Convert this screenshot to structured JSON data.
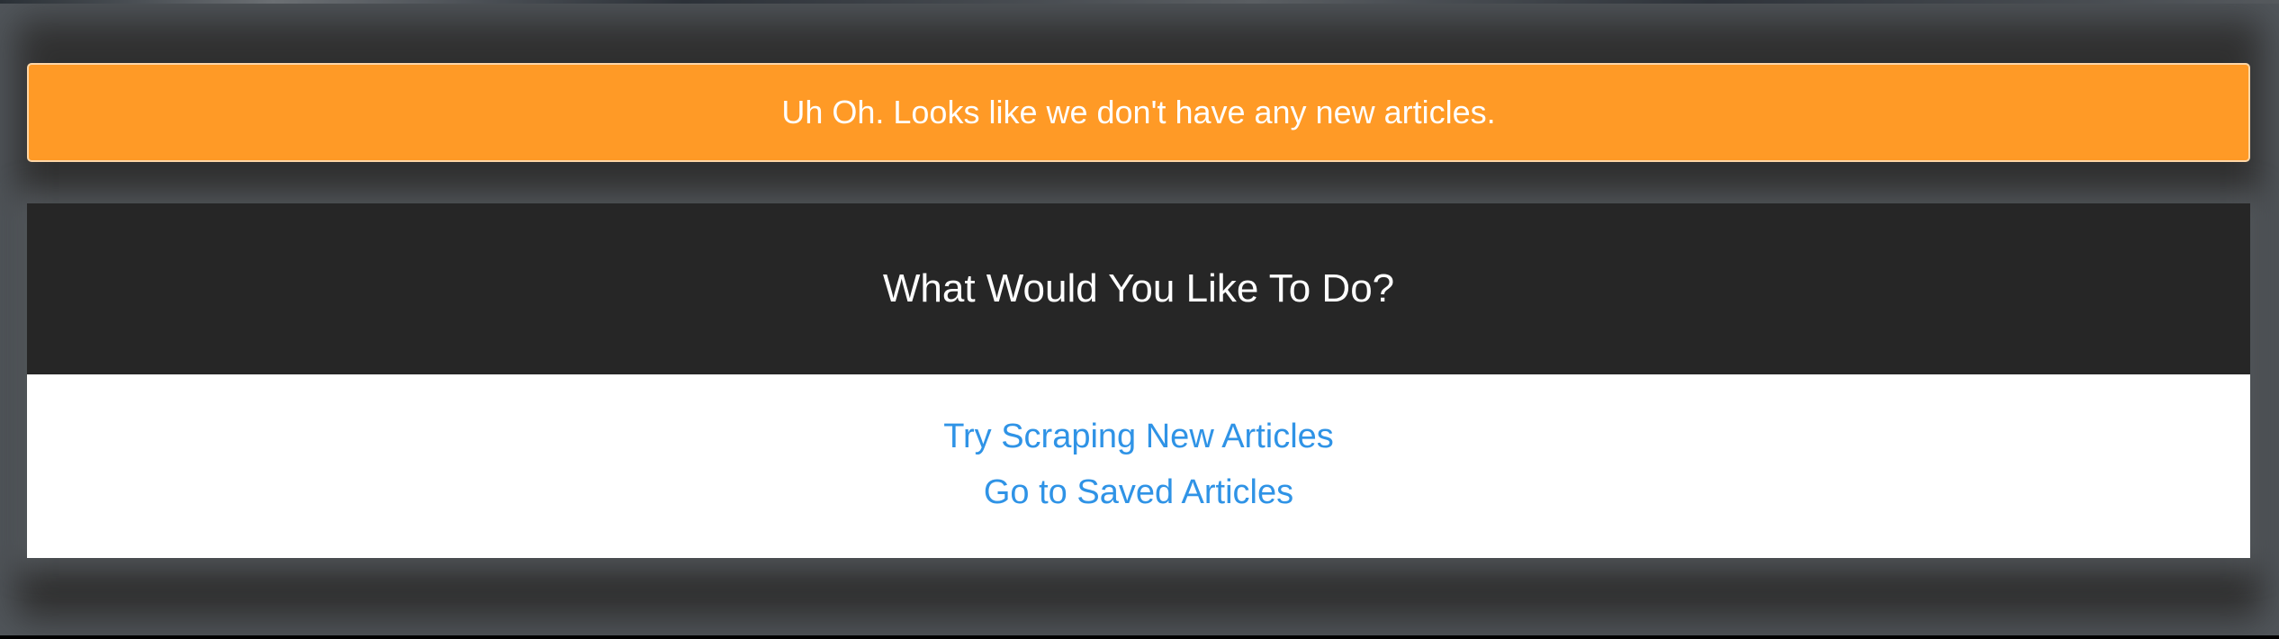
{
  "alert": {
    "message": "Uh Oh. Looks like we don't have any new articles."
  },
  "panel": {
    "title": "What Would You Like To Do?",
    "actions": [
      {
        "label": "Try Scraping New Articles"
      },
      {
        "label": "Go to Saved Articles"
      }
    ]
  },
  "colors": {
    "alert_bg": "#ff9a26",
    "panel_header_bg": "#262626",
    "link": "#2f93e6",
    "page_bg": "#303030"
  }
}
